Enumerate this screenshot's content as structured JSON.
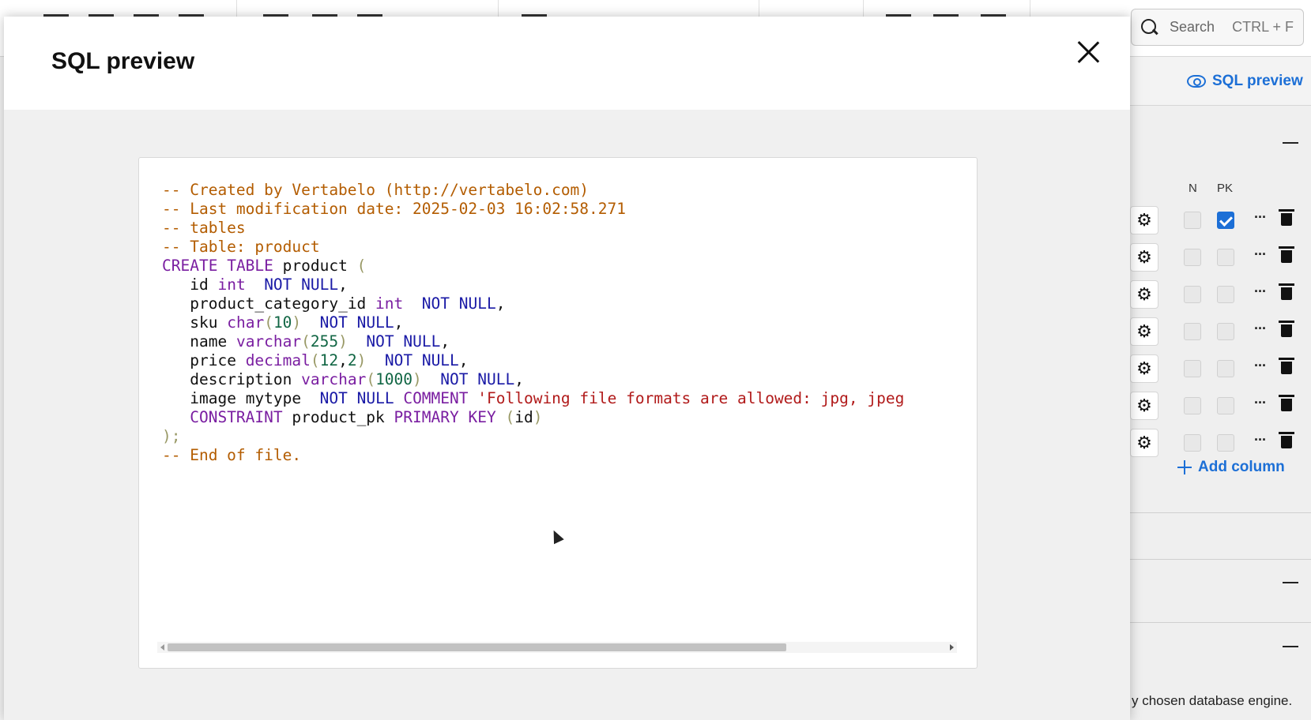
{
  "background": {
    "search": {
      "placeholder": "Search",
      "shortcut": "CTRL + F"
    },
    "sql_preview_link": "SQL preview",
    "column_headers": {
      "n": "N",
      "pk": "PK"
    },
    "add_column": "Add column",
    "engine_note": "y chosen database engine."
  },
  "modal": {
    "title": "SQL preview",
    "sql_lines": [
      "-- Created by Vertabelo (http://vertabelo.com)",
      "-- Last modification date: 2025-02-03 16:02:58.271",
      "-- tables",
      "-- Table: product",
      "CREATE TABLE product (",
      "   id int  NOT NULL,",
      "   product_category_id int  NOT NULL,",
      "   sku char(10)  NOT NULL,",
      "   name varchar(255)  NOT NULL,",
      "   price decimal(12,2)  NOT NULL,",
      "   description varchar(1000)  NOT NULL,",
      "   image mytype  NOT NULL COMMENT 'Following file formats are allowed: jpg, jpeg",
      "   CONSTRAINT product_pk PRIMARY KEY (id)",
      ");",
      "-- End of file."
    ]
  },
  "colors": {
    "accent": "#1c6fd6",
    "comment": "#b35c00",
    "keyword": "#7a1ea1",
    "constraint_keyword": "#1a1aa6",
    "number": "#116644",
    "string": "#b11a1a"
  }
}
